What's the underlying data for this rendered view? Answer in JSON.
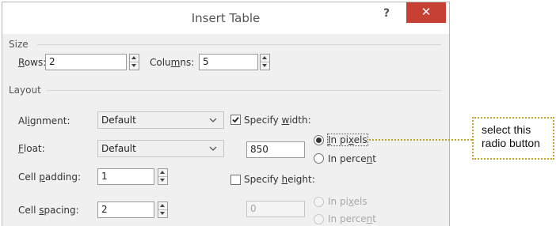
{
  "dialog": {
    "title": "Insert Table",
    "help": "?",
    "close": "✕"
  },
  "size": {
    "section": "Size",
    "rows_label": "Rows:",
    "rows_value": "2",
    "columns_label": "Columns:",
    "columns_value": "5"
  },
  "layout": {
    "section": "Layout",
    "alignment_label": "Alignment:",
    "alignment_value": "Default",
    "float_label": "Float:",
    "float_value": "Default",
    "cell_padding_label": "Cell padding:",
    "cell_padding_value": "1",
    "cell_spacing_label": "Cell spacing:",
    "cell_spacing_value": "2",
    "specify_width_label": "Specify width:",
    "specify_width_checked": true,
    "width_value": "850",
    "width_pixels_label": "In pixels",
    "width_percent_label": "In percent",
    "specify_height_label": "Specify height:",
    "specify_height_checked": false,
    "height_value": "0",
    "height_pixels_label": "In pixels",
    "height_percent_label": "In percent"
  },
  "callout": {
    "line1": "select this",
    "line2": "radio button"
  },
  "colors": {
    "close_red": "#c74034",
    "callout_gold": "#c8a32c",
    "dialog_bg": "#f0f0f0"
  },
  "icons": [
    "help-icon",
    "close-icon",
    "chevron-down-icon",
    "checkmark-icon",
    "spinner-up-icon",
    "spinner-down-icon"
  ]
}
